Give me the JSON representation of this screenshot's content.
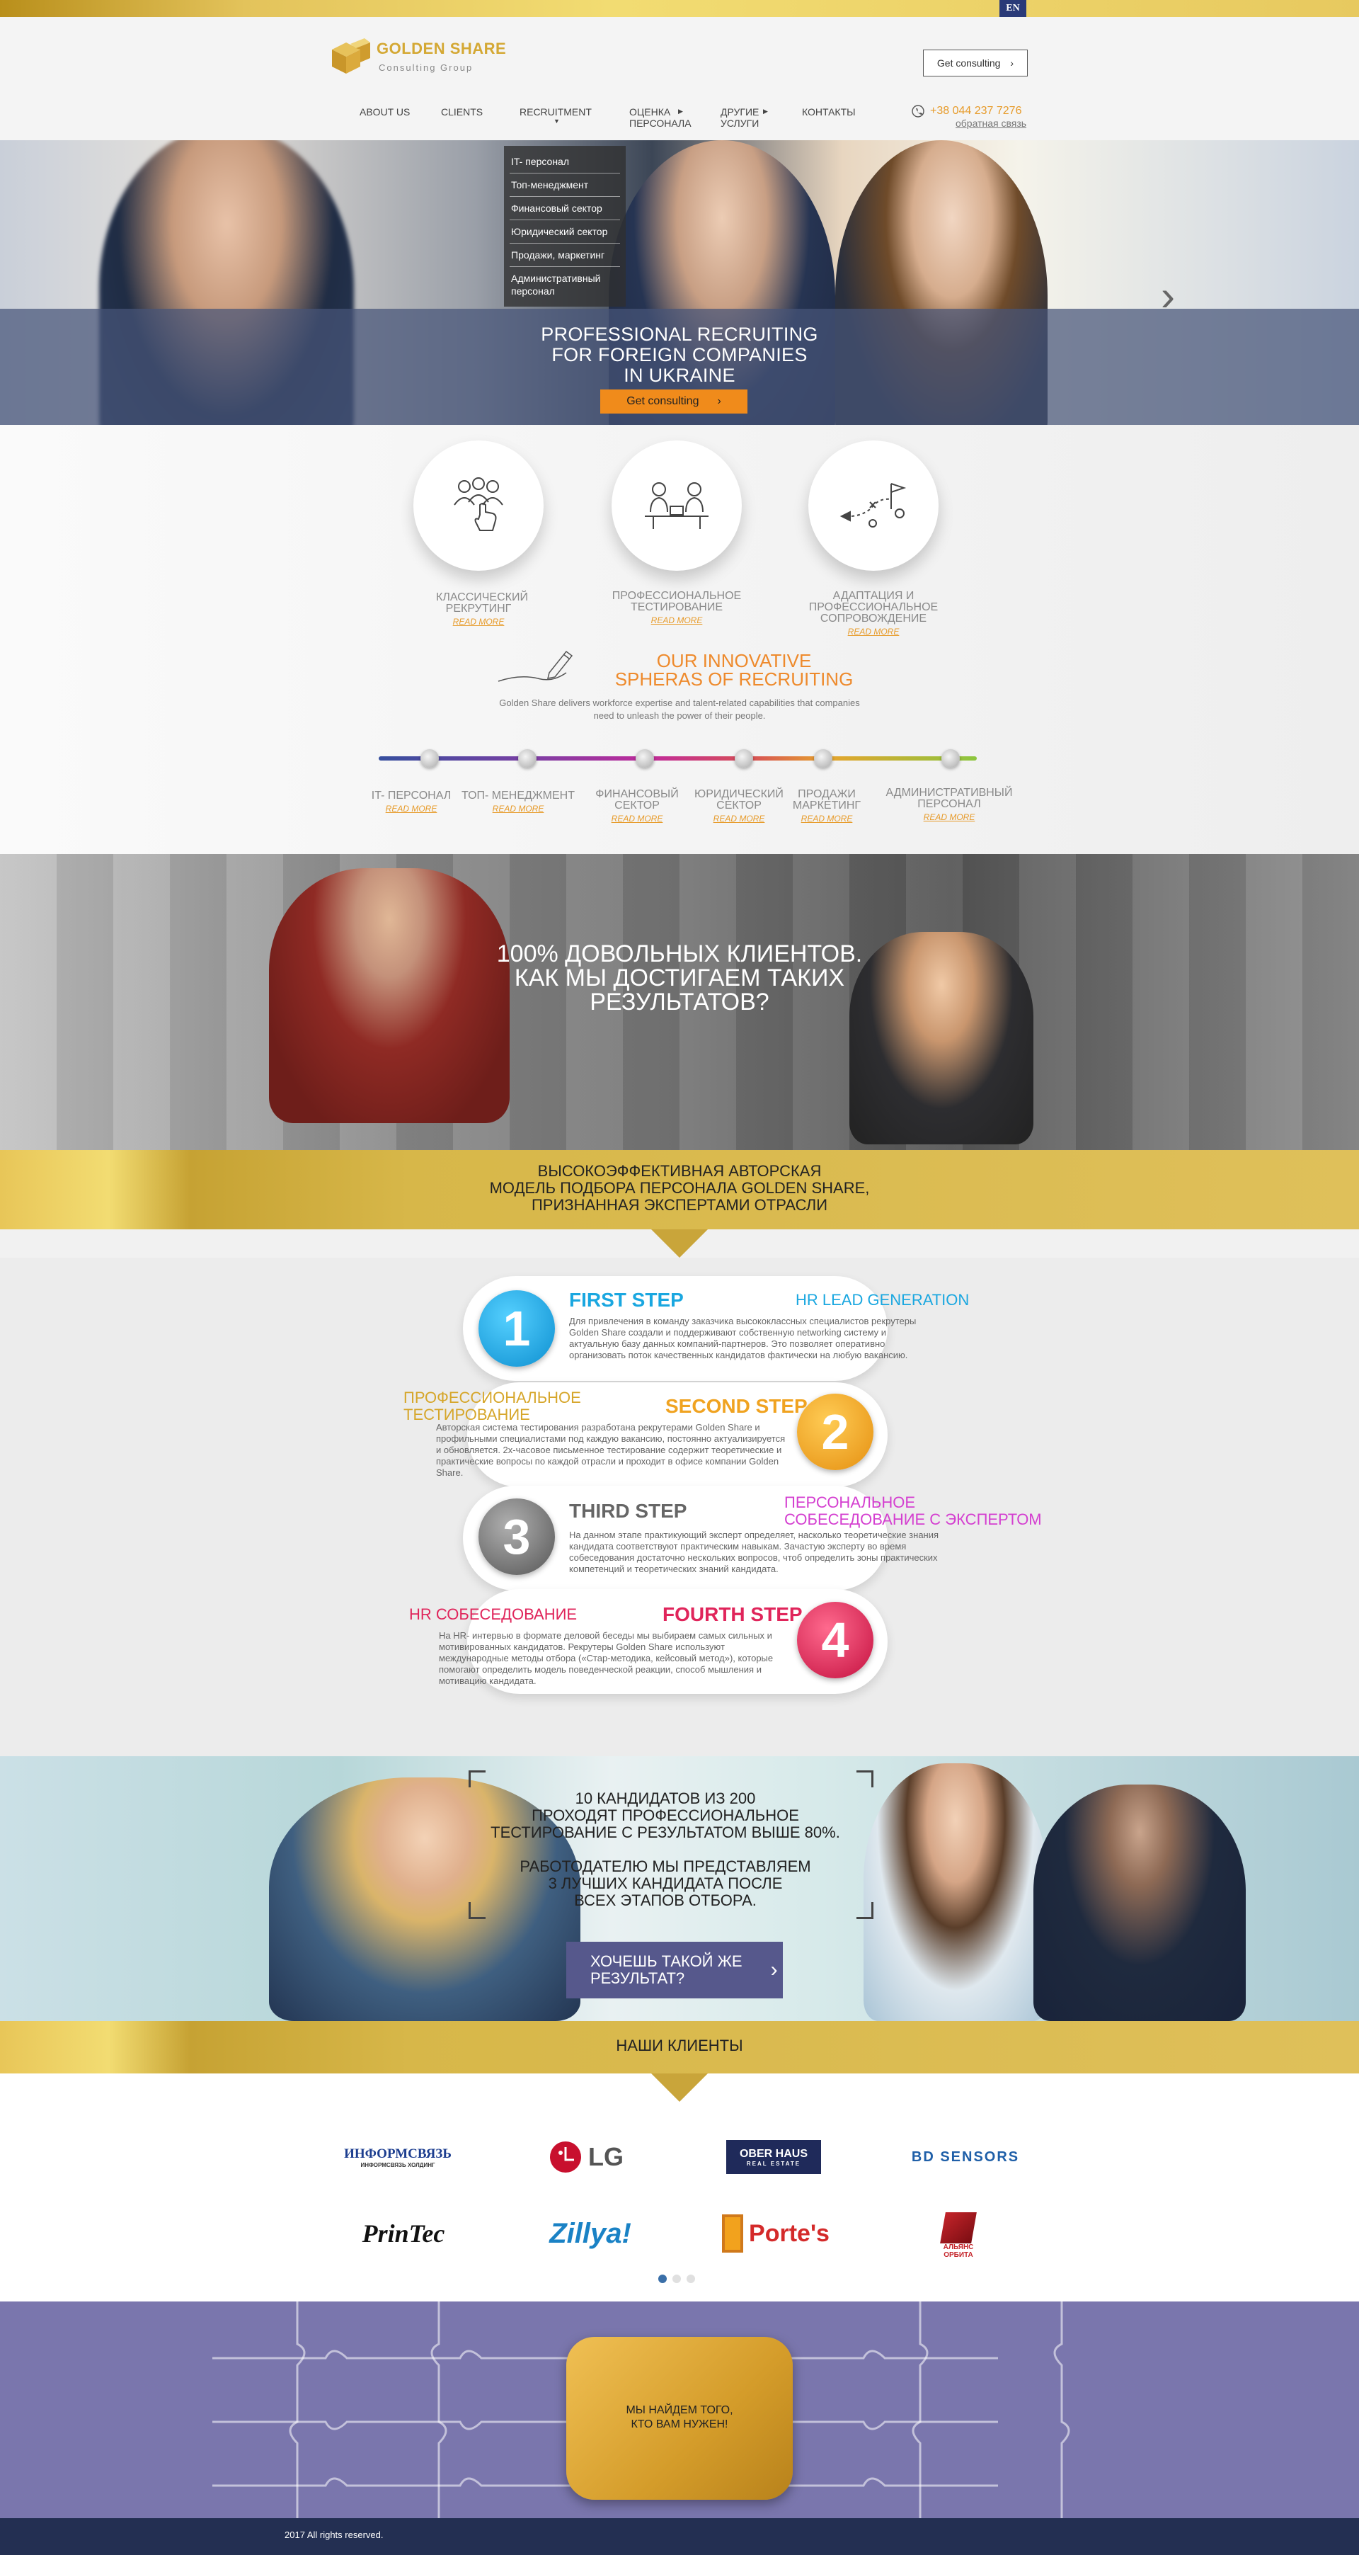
{
  "lang": {
    "current": "EN"
  },
  "header": {
    "logo_title": "GOLDEN SHARE",
    "logo_subtitle": "Consulting Group",
    "consult_button": "Get consulting",
    "phone": "+38 044 237 7276",
    "feedback": "обратная связь",
    "nav": [
      {
        "label": "ABOUT US",
        "dropdown": false
      },
      {
        "label": "CLIENTS",
        "dropdown": false
      },
      {
        "label": "RECRUITMENT",
        "dropdown": true
      },
      {
        "label": "ОЦЕНКА ПЕРСОНАЛА",
        "dropdown": true
      },
      {
        "label": "ДРУГИЕ УСЛУГИ",
        "dropdown": true
      },
      {
        "label": "КОНТАКТЫ",
        "dropdown": false
      }
    ],
    "recruitment_menu": [
      "IT- персонал",
      "Топ-менеджмент",
      "Финансовый сектор",
      "Юридический сектор",
      "Продажи, маркетинг",
      "Административный персонал"
    ]
  },
  "hero": {
    "title_lines": [
      "PROFESSIONAL RECRUITING",
      "FOR FOREIGN COMPANIES",
      "IN UKRAINE"
    ],
    "button": "Get consulting"
  },
  "services": {
    "items": [
      {
        "label": "КЛАССИЧЕСКИЙ РЕКРУТИНГ",
        "link": "read more",
        "icon": "group-pointing-icon"
      },
      {
        "label": "ПРОФЕССИОНАЛЬНОЕ ТЕСТИРОВАНИЕ",
        "link": "read more",
        "icon": "interview-icon"
      },
      {
        "label": "АДАПТАЦИЯ И ПРОФЕССИОНАЛЬНОЕ СОПРОВОЖДЕНИЕ",
        "link": "read more",
        "icon": "strategy-path-icon"
      }
    ]
  },
  "innovative": {
    "title_lines": [
      "OUR INNOVATIVE",
      "SPHERAS OF RECRUITING"
    ],
    "description": "Golden Share delivers workforce expertise and talent-related capabilities that companies need to unleash the power of their people.",
    "spheres": [
      {
        "label": "IT- ПЕРСОНАЛ",
        "link": "read more"
      },
      {
        "label": "ТОП- МЕНЕДЖМЕНТ",
        "link": "read more"
      },
      {
        "label": "ФИНАНСОВЫЙ СЕКТОР",
        "link": "read more"
      },
      {
        "label": "ЮРИДИЧЕСКИЙ СЕКТОР",
        "link": "read more"
      },
      {
        "label": "ПРОДАЖИ МАРКЕТИНГ",
        "link": "read more"
      },
      {
        "label": "АДМИНИСТРАТИВНЫЙ ПЕРСОНАЛ",
        "link": "read more"
      }
    ]
  },
  "results": {
    "title_lines": [
      "100% ДОВОЛЬНЫХ КЛИЕНТОВ.",
      "КАК МЫ ДОСТИГАЕМ ТАКИХ",
      "РЕЗУЛЬТАТОВ?"
    ]
  },
  "model": {
    "title_lines": [
      "ВЫСОКОЭФФЕКТИВНАЯ АВТОРСКАЯ",
      "МОДЕЛЬ ПОДБОРА ПЕРСОНАЛА GOLDEN SHARE,",
      "ПРИЗНАННАЯ ЭКСПЕРТАМИ ОТРАСЛИ"
    ]
  },
  "steps": [
    {
      "num": "1",
      "title": "FIRST STEP",
      "side": "HR LEAD GENERATION",
      "color": "#1aa7e0",
      "text": "Для привлечения в команду заказчика высококлассных специалистов рекрутеры Golden Share создали и поддерживают собственную networking систему и актуальную базу данных компаний-партнеров. Это позволяет оперативно организовать поток качественных кандидатов фактически на любую вакансию."
    },
    {
      "num": "2",
      "title": "SECOND STEP",
      "side": "ПРОФЕССИОНАЛЬНОЕ ТЕСТИРОВАНИЕ",
      "color": "#f0a321",
      "text": "Авторская система тестирования разработана рекрутерами Golden Share и профильными специалистами под каждую вакансию, постоянно актуализируется и обновляется. 2х-часовое письменное тестирование содержит теоретические и практические вопросы по каждой отрасли и проходит в офисе компании Golden Share."
    },
    {
      "num": "3",
      "title": "THIRD STEP",
      "side": "ПЕРСОНАЛЬНОЕ СОБЕСЕДОВАНИЕ С ЭКСПЕРТОМ",
      "color": "#7a7a7a",
      "side_color": "#d43fd0",
      "text": "На данном этапе практикующий эксперт определяет, насколько теоретические знания кандидата соответствуют практическим навыкам. Зачастую эксперту во время собеседования достаточно нескольких вопросов, чтоб определить зоны практических компетенций и теоретических знаний кандидата."
    },
    {
      "num": "4",
      "title": "FOURTH STEP",
      "side": "HR СОБЕСЕДОВАНИЕ",
      "color": "#e0255b",
      "text": "На HR- интервью в формате деловой беседы мы выбираем самых сильных и мотивированных кандидатов. Рекрутеры Golden Share используют международные методы отбора («Стар-методика, кейсовый метод»), которые помогают определить модель поведенческой реакции, способ мышления и мотивацию кандидата."
    }
  ],
  "candidates": {
    "text_lines_1": [
      "10 КАНДИДАТОВ ИЗ 200",
      "ПРОХОДЯТ ПРОФЕССИОНАЛЬНОЕ",
      "ТЕСТИРОВАНИЕ С РЕЗУЛЬТАТОМ ВЫШЕ 80%."
    ],
    "text_lines_2": [
      "РАБОТОДАТЕЛЮ МЫ ПРЕДСТАВЛЯЕМ",
      "3 ЛУЧШИХ КАНДИДАТА ПОСЛЕ",
      "ВСЕХ ЭТАПОВ ОТБОРА."
    ],
    "button_lines": [
      "ХОЧЕШЬ ТАКОЙ ЖЕ",
      "РЕЗУЛЬТАТ?"
    ]
  },
  "clients": {
    "title": "НАШИ КЛИЕНТЫ",
    "logos": [
      {
        "text": "ИНФОРМСВЯЗЬ",
        "sub": "ИНФОРМСВЯЗЬ ХОЛДИНГ",
        "color": "#1c3d8f"
      },
      {
        "text": "LG",
        "color": "#555"
      },
      {
        "text": "OBER HAUS",
        "sub": "REAL ESTATE",
        "color": "#fff",
        "bg": "#1f2a5a"
      },
      {
        "text": "BD SENSORS",
        "color": "#1f5fa8"
      },
      {
        "text": "PrinTec",
        "color": "#111"
      },
      {
        "text": "Zillya!",
        "color": "#1a82c5"
      },
      {
        "text": "Porte's",
        "color": "#d42a2a"
      },
      {
        "text": "АЛЬЯНС ОРБИТА",
        "color": "#c4242a"
      }
    ],
    "pages": 3,
    "active_page": 1
  },
  "puzzle": {
    "text_lines": [
      "МЫ НАЙДЕМ ТОГО,",
      "КТО ВАМ НУЖЕН!"
    ]
  },
  "footer": {
    "copyright": "2017 All rights reserved."
  }
}
